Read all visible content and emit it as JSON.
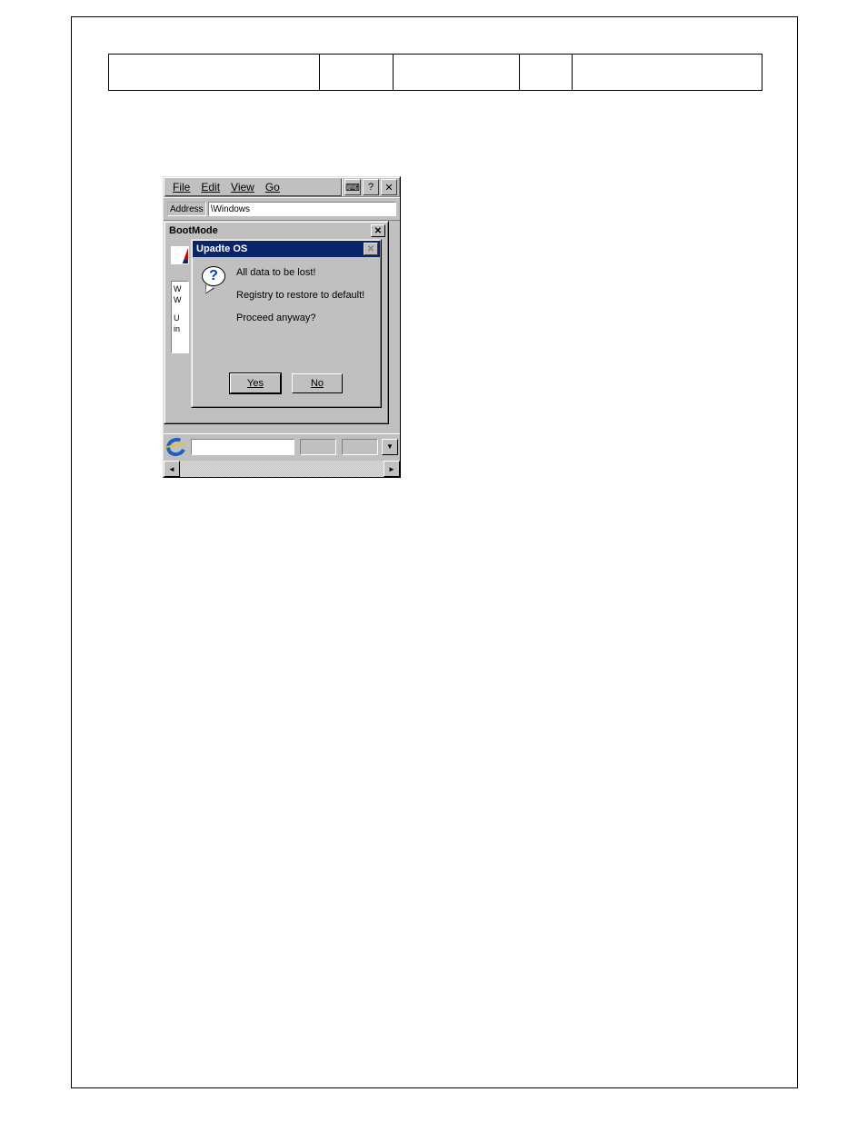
{
  "menubar": {
    "file": "File",
    "edit": "Edit",
    "view": "View",
    "go": "Go",
    "keyboard_icon": "⌨",
    "help": "?",
    "close": "✕"
  },
  "address": {
    "label": "Address",
    "value": "\\Windows"
  },
  "bootmode": {
    "title": "BootMode",
    "close": "✕",
    "panel": {
      "line1": "W",
      "line2": "W",
      "line3": "U",
      "line4": "in"
    }
  },
  "updateos": {
    "title": "Upadte OS",
    "close": "✕",
    "msg1": "All data to be lost!",
    "msg2": "Registry to restore to default!",
    "msg3": "Proceed anyway?",
    "yes": "Yes",
    "no": "No",
    "question_mark": "?"
  },
  "scroll": {
    "left": "◄",
    "right": "►",
    "down": "▼"
  }
}
